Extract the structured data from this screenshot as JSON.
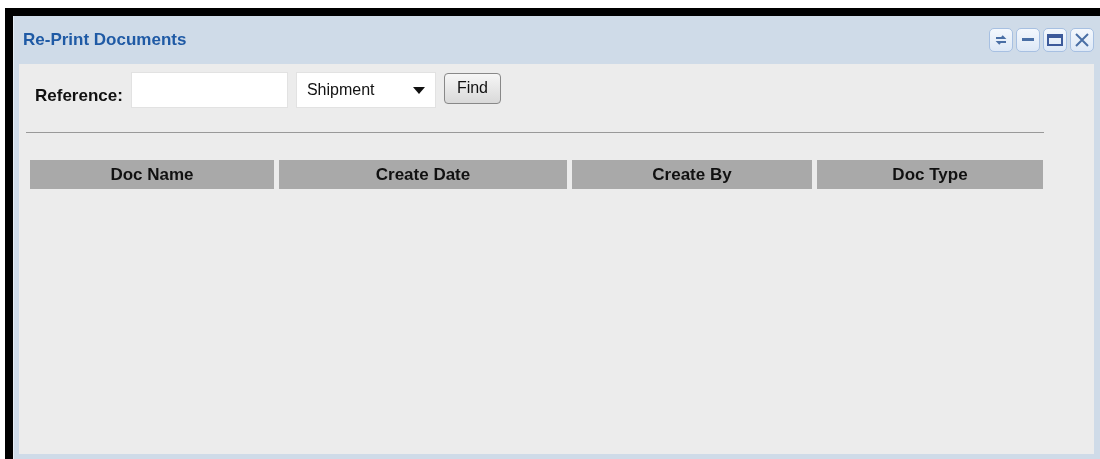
{
  "window": {
    "title": "Re-Print Documents"
  },
  "search": {
    "label": "Reference:",
    "type_value": "Shipment",
    "button": "Find"
  },
  "table": {
    "columns": [
      "Doc Name",
      "Create Date",
      "Create By",
      "Doc Type"
    ]
  }
}
